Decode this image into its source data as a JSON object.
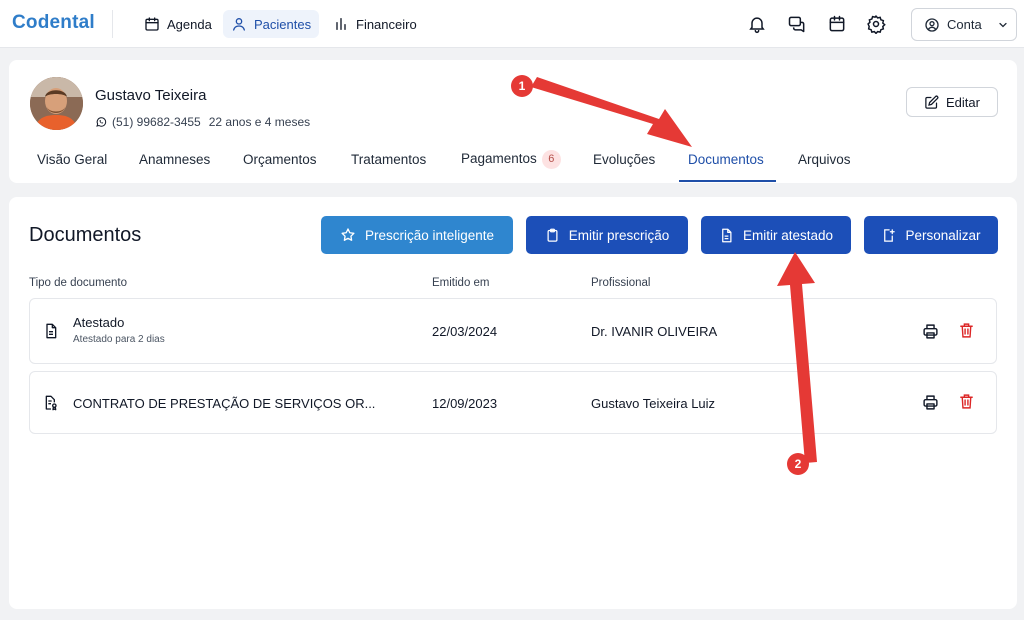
{
  "app": {
    "logo": "Codental"
  },
  "nav": {
    "items": [
      {
        "label": "Agenda",
        "icon": "calendar-icon",
        "active": false
      },
      {
        "label": "Pacientes",
        "icon": "user-icon",
        "active": true
      },
      {
        "label": "Financeiro",
        "icon": "bar-chart-icon",
        "active": false
      }
    ],
    "icons": [
      "bell-icon",
      "chat-icon",
      "calendar-icon",
      "gear-icon"
    ],
    "account_label": "Conta"
  },
  "patient": {
    "name": "Gustavo Teixeira",
    "phone": "(51) 99682-3455",
    "age": "22 anos e 4 meses",
    "edit_label": "Editar",
    "tabs": [
      {
        "label": "Visão Geral"
      },
      {
        "label": "Anamneses"
      },
      {
        "label": "Orçamentos"
      },
      {
        "label": "Tratamentos"
      },
      {
        "label": "Pagamentos",
        "badge": "6"
      },
      {
        "label": "Evoluções"
      },
      {
        "label": "Documentos",
        "active": true
      },
      {
        "label": "Arquivos"
      }
    ]
  },
  "documents": {
    "title": "Documentos",
    "buttons": {
      "smart_prescription": "Prescrição inteligente",
      "issue_prescription": "Emitir prescrição",
      "issue_certificate": "Emitir atestado",
      "customize": "Personalizar"
    },
    "columns": {
      "type": "Tipo de documento",
      "issued": "Emitido em",
      "professional": "Profissional"
    },
    "rows": [
      {
        "title": "Atestado",
        "subtitle": "Atestado para 2 dias",
        "date": "22/03/2024",
        "professional": "Dr. IVANIR OLIVEIRA"
      },
      {
        "title": "CONTRATO DE PRESTAÇÃO DE SERVIÇOS OR...",
        "subtitle": "",
        "date": "12/09/2023",
        "professional": "Gustavo Teixeira Luiz"
      }
    ]
  },
  "annotations": {
    "marker_1": "1",
    "marker_2": "2"
  },
  "colors": {
    "brand": "#2f7dc9",
    "primary": "#1c4fb8",
    "accent_light": "#2f86cf",
    "danger": "#dc2626",
    "annotation": "#e53935"
  }
}
